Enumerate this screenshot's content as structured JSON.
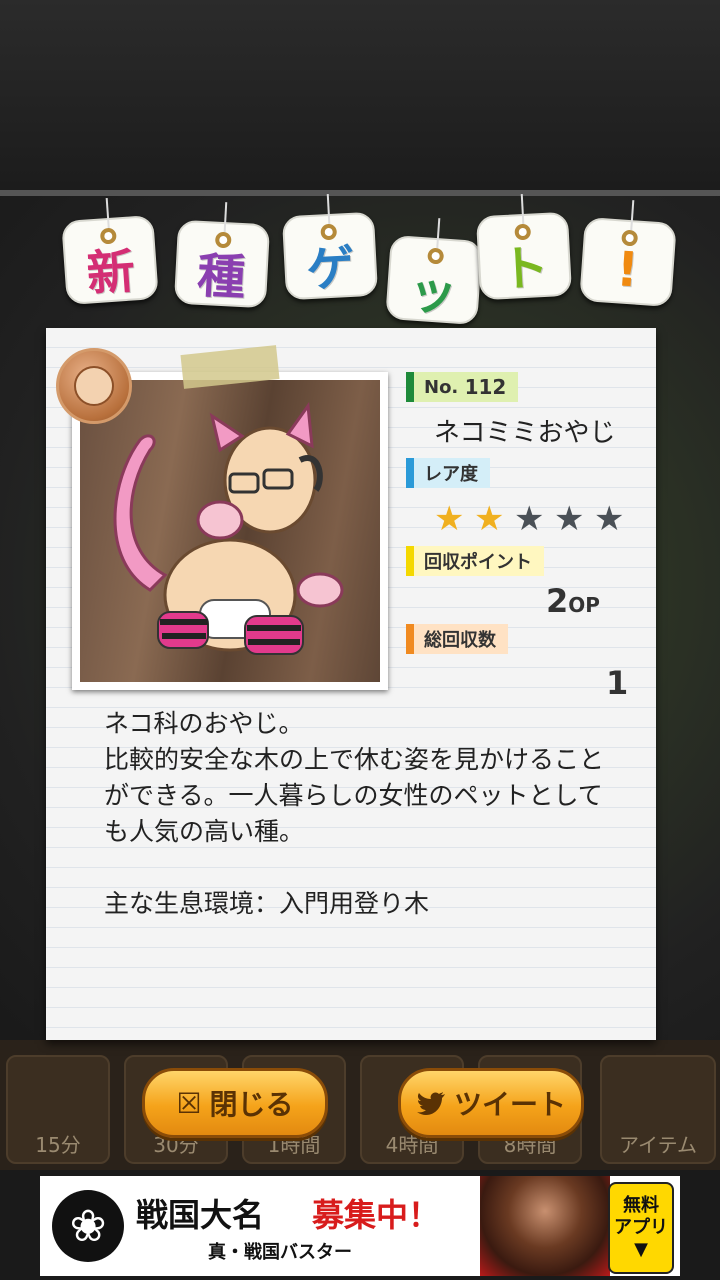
{
  "header_tags": [
    {
      "char": "新",
      "color": "#d42e74"
    },
    {
      "char": "種",
      "color": "#8a3fb0"
    },
    {
      "char": "ゲ",
      "color": "#2a7ec4"
    },
    {
      "char": "ッ",
      "color": "#2c9a4a"
    },
    {
      "char": "ト",
      "color": "#7ab820"
    },
    {
      "char": "!",
      "color": "#f08a10"
    }
  ],
  "creature": {
    "no_label": "No.",
    "number": "112",
    "name": "ネコミミおやじ",
    "rarity_label": "レア度",
    "rarity": 2,
    "rarity_max": 5,
    "points_label": "回収ポイント",
    "points": "2",
    "points_unit": "OP",
    "total_label": "総回収数",
    "total": "1",
    "description": "ネコ科のおやじ。\n比較的安全な木の上で休む姿を見かけることができる。一人暮らしの女性のペットとしても人気の高い種。\n\n主な生息環境：入門用登り木"
  },
  "buttons": {
    "close_label": "閉じる",
    "tweet_label": "ツイート"
  },
  "tray": [
    {
      "label": "15分"
    },
    {
      "label": "30分"
    },
    {
      "label": "1時間"
    },
    {
      "label": "4時間"
    },
    {
      "label": "8時間"
    },
    {
      "label": "アイテム"
    }
  ],
  "ad": {
    "title": "戦国大名",
    "headline": "募集中！",
    "subtitle": "真・戦国バスター",
    "badge_line1": "無料",
    "badge_line2": "アプリ"
  },
  "colors": {
    "label_no": "#1e8a3a",
    "label_rarity": "#2a9ad8",
    "label_points": "#f4d800",
    "label_total": "#f08a20",
    "star_on": "#f0b020",
    "star_off": "#4a5056"
  }
}
